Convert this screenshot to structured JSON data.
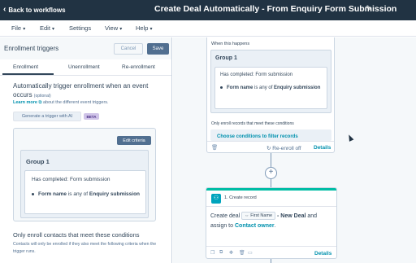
{
  "topbar": {
    "back_label": "Back to workflows",
    "title": "Create Deal Automatically - From Enquiry Form Submission"
  },
  "menu": [
    "File",
    "Edit",
    "Settings",
    "View",
    "Help"
  ],
  "panel": {
    "title": "Enrollment triggers",
    "cancel_label": "Cancel",
    "save_label": "Save",
    "tabs": [
      "Enrollment",
      "Unenrollment",
      "Re-enrollment"
    ],
    "active_tab": "Enrollment",
    "auto_heading": "Automatically trigger enrollment when an event occurs",
    "optional": "(optional)",
    "learn_link": "Learn more",
    "learn_rest": "about the different event triggers.",
    "generate_label": "Generate a trigger with AI",
    "beta_label": "BETA",
    "edit_criteria_label": "Edit criteria",
    "group_label": "Group 1",
    "condition_title": "Has completed: Form submission",
    "condition_property": "Form name",
    "condition_operator": "is any of",
    "condition_value": "Enquiry submission",
    "only_enroll_heading": "Only enroll contacts that meet these conditions",
    "only_enroll_desc": "Contacts will only be enrolled if they also meet the following criteria when the trigger runs."
  },
  "canvas": {
    "trigger": {
      "when_label": "When this happens",
      "group_label": "Group 1",
      "condition_title": "Has completed: Form submission",
      "condition_property": "Form name",
      "condition_operator": "is any of",
      "condition_value": "Enquiry submission",
      "only_records": "Only enroll records that meet these conditions",
      "choose_filters": "Choose conditions to filter records",
      "reenroll_label": "Re-enroll off",
      "details_label": "Details"
    },
    "add_label": "+",
    "action": {
      "title": "1. Create record",
      "prefix": "Create deal",
      "token_label": "First Name",
      "deal_name": "- New Deal",
      "and_assign": "and assign to",
      "owner": "Contact owner",
      "period": ".",
      "details_label": "Details"
    }
  },
  "colors": {
    "header_bg": "#213343",
    "save_bg": "#516f90",
    "link": "#0091ae",
    "action_accent": "#00bda5"
  }
}
